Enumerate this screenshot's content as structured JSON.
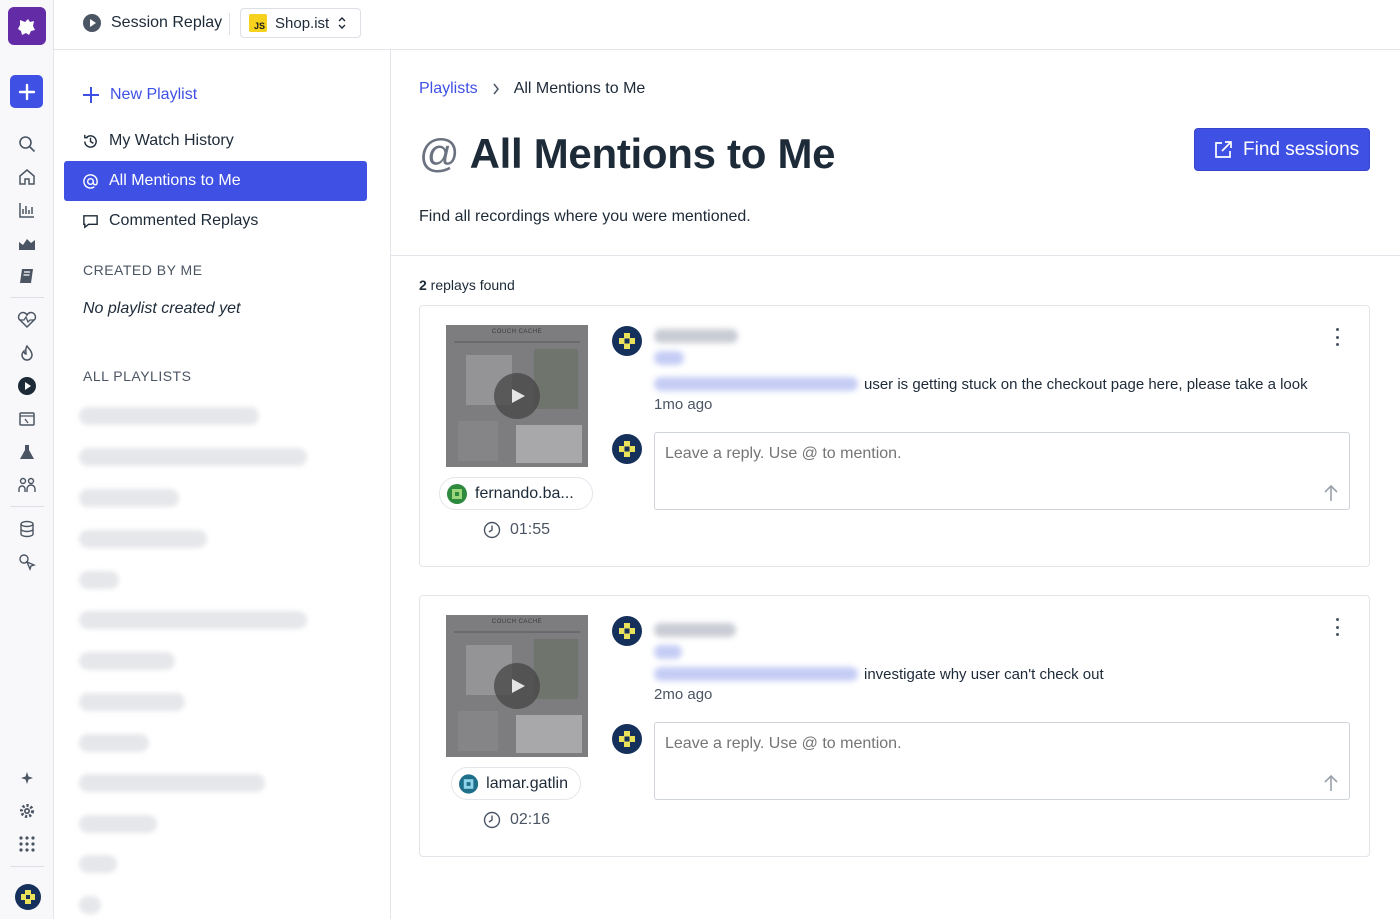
{
  "topbar": {
    "product": "Session Replay",
    "app_badge": "JS",
    "app_name": "Shop.ist"
  },
  "sidebar": {
    "new_playlist": "New Playlist",
    "items": [
      {
        "label": "My Watch History"
      },
      {
        "label": "All Mentions to Me"
      },
      {
        "label": "Commented Replays"
      }
    ],
    "created_by_me_heading": "CREATED BY ME",
    "created_empty": "No playlist created yet",
    "all_playlists_heading": "ALL PLAYLISTS"
  },
  "main": {
    "breadcrumb_root": "Playlists",
    "breadcrumb_current": "All Mentions to Me",
    "title_symbol": "@",
    "title": "All Mentions to Me",
    "find_sessions": "Find sessions",
    "subtitle": "Find all recordings where you were mentioned.",
    "count_number": "2",
    "count_label": " replays found",
    "replays": [
      {
        "thumb_brand": "COUCH CACHE",
        "user": "fernando.ba...",
        "duration": "01:55",
        "comment": "user is getting stuck on the checkout page here, please take a look",
        "time": "1mo ago",
        "reply_placeholder": "Leave a reply. Use @ to mention."
      },
      {
        "thumb_brand": "COUCH CACHE",
        "user": "lamar.gatlin",
        "duration": "02:16",
        "comment": "investigate why user can't check out",
        "time": "2mo ago",
        "reply_placeholder": "Leave a reply. Use @ to mention."
      }
    ]
  },
  "colors": {
    "accent": "#3f51e5",
    "brand": "#632ca6"
  }
}
